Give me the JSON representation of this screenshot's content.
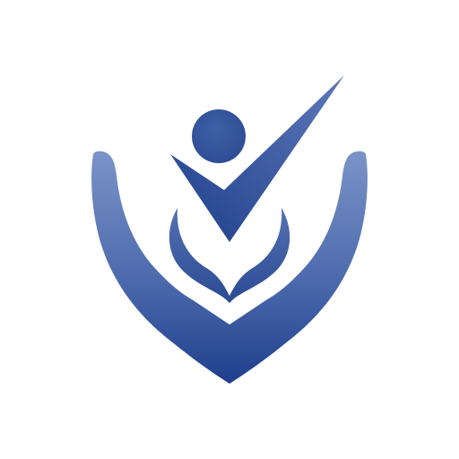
{
  "logo": {
    "description_free": true,
    "colors": {
      "primary_light": "#7b93c7",
      "primary_mid": "#4c6aad",
      "primary_dark": "#1f3f8c",
      "background": "#ffffff"
    },
    "icons": [
      "person-head-icon",
      "checkmark-icon",
      "hands-icon",
      "flame-icon"
    ]
  }
}
